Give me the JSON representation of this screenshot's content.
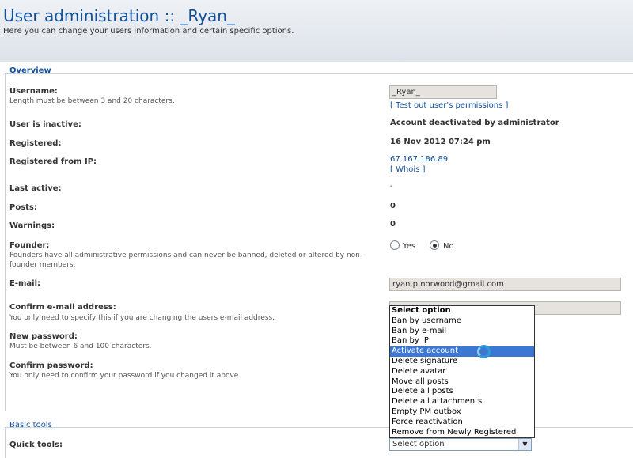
{
  "header": {
    "title": "User administration :: _Ryan_",
    "description": "Here you can change your users information and certain specific options."
  },
  "overview": {
    "legend": "Overview",
    "username": {
      "label": "Username:",
      "explain": "Length must be between 3 and 20 characters.",
      "value": "_Ryan_",
      "link": "[ Test out user's permissions ]"
    },
    "inactive": {
      "label": "User is inactive:",
      "value": "Account deactivated by administrator"
    },
    "registered": {
      "label": "Registered:",
      "value": "16 Nov 2012 07:24 pm"
    },
    "registered_ip": {
      "label": "Registered from IP:",
      "ip": "67.167.186.89",
      "whois": "[ Whois ]"
    },
    "last_active": {
      "label": "Last active:",
      "value": "-"
    },
    "posts": {
      "label": "Posts:",
      "value": "0"
    },
    "warnings": {
      "label": "Warnings:",
      "value": "0"
    },
    "founder": {
      "label": "Founder:",
      "explain": "Founders have all administrative permissions and can never be banned, deleted or altered by non-founder members.",
      "yes": "Yes",
      "no": "No",
      "selected": "No"
    },
    "email": {
      "label": "E-mail:",
      "value": "ryan.p.norwood@gmail.com"
    },
    "confirm_email": {
      "label": "Confirm e-mail address:",
      "explain": "You only need to specify this if you are changing the users e-mail address."
    },
    "new_password": {
      "label": "New password:",
      "explain": "Must be between 6 and 100 characters."
    },
    "confirm_password": {
      "label": "Confirm password:",
      "explain": "You only need to confirm your password if you changed it above."
    }
  },
  "basic_tools": {
    "legend": "Basic tools",
    "quick_tools_label": "Quick tools:",
    "select_value": "Select option"
  },
  "dropdown": {
    "options": [
      "Select option",
      "Ban by username",
      "Ban by e-mail",
      "Ban by IP",
      "Activate account",
      "Delete signature",
      "Delete avatar",
      "Move all posts",
      "Delete all posts",
      "Delete all attachments",
      "Empty PM outbox",
      "Force reactivation",
      "Remove from Newly Registered"
    ],
    "highlighted": "Activate account"
  }
}
